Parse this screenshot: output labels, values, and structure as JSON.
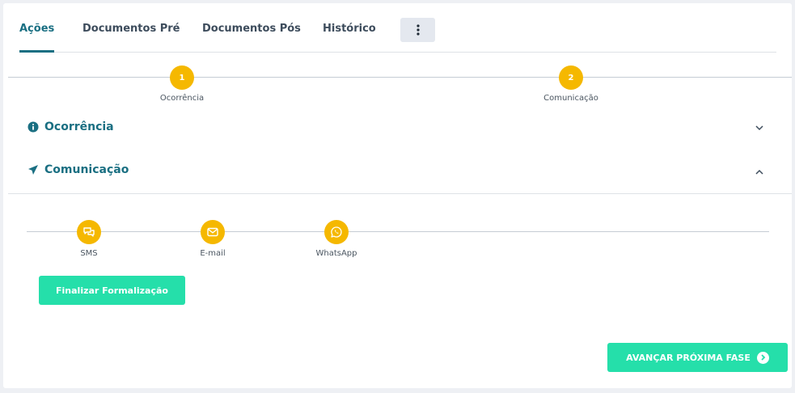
{
  "tabs": [
    {
      "label": "Ações",
      "active": true
    },
    {
      "label": "Documentos Pré"
    },
    {
      "label": "Documentos Pós"
    },
    {
      "label": "Histórico"
    }
  ],
  "stepper": [
    {
      "number": "1",
      "label": "Ocorrência"
    },
    {
      "number": "2",
      "label": "Comunicação"
    }
  ],
  "sections": {
    "occurrence": {
      "title": "Ocorrência",
      "icon": "info-circle-icon",
      "expanded": false
    },
    "communication": {
      "title": "Comunicação",
      "icon": "paper-plane-icon",
      "expanded": true
    }
  },
  "channels": [
    {
      "label": "SMS",
      "icon": "chat-bubbles-icon"
    },
    {
      "label": "E-mail",
      "icon": "envelope-icon"
    },
    {
      "label": "WhatsApp",
      "icon": "whatsapp-icon"
    }
  ],
  "buttons": {
    "finalize": "Finalizar Formalização",
    "next_phase": "AVANÇAR PRÓXIMA FASE"
  },
  "colors": {
    "accent": "#1a6f82",
    "step": "#f5b800",
    "primary_button": "#25dfaa"
  }
}
